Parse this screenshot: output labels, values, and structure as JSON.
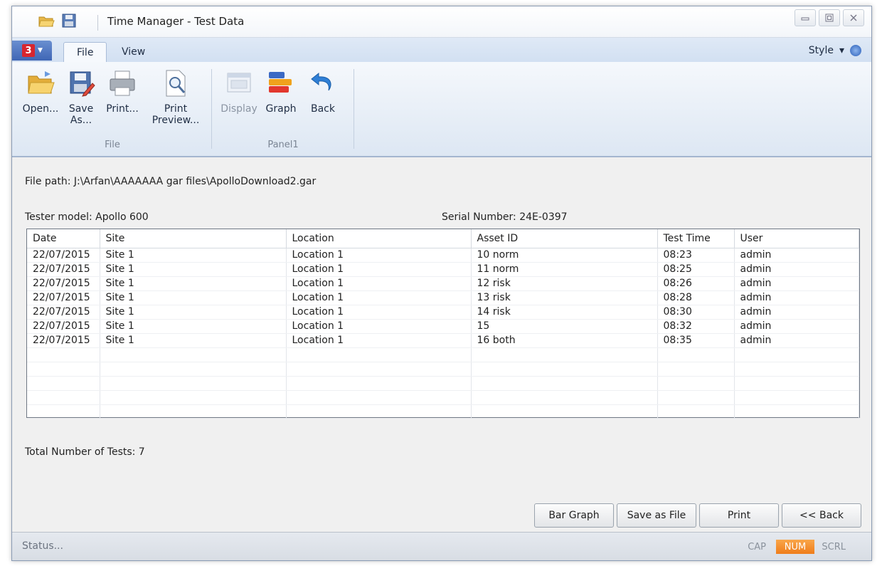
{
  "window": {
    "title": "Time Manager - Test Data"
  },
  "tabs": [
    {
      "label": "File",
      "active": true
    },
    {
      "label": "View",
      "active": false
    }
  ],
  "app_button": {
    "logo_text": "3"
  },
  "style_menu": {
    "label": "Style",
    "arrow": "▾"
  },
  "ribbon": {
    "groups": [
      {
        "label": "File",
        "buttons": [
          {
            "label": "Open...",
            "icon": "folder-open-icon"
          },
          {
            "label": "Save As...",
            "icon": "save-as-icon"
          },
          {
            "label": "Print...",
            "icon": "printer-icon"
          },
          {
            "label": "Print Preview...",
            "icon": "print-preview-icon"
          }
        ]
      },
      {
        "label": "Panel1",
        "buttons": [
          {
            "label": "Display",
            "icon": "display-icon",
            "disabled": true
          },
          {
            "label": "Graph",
            "icon": "graph-icon"
          },
          {
            "label": "Back",
            "icon": "back-arrow-icon"
          }
        ]
      }
    ]
  },
  "info": {
    "file_path": "File path: J:\\Arfan\\AAAAAAA gar files\\ApolloDownload2.gar",
    "tester_model": "Tester model: Apollo 600",
    "serial_number": "Serial Number: 24E-0397",
    "total_tests": "Total Number of Tests: 7"
  },
  "table": {
    "columns": [
      "Date",
      "Site",
      "Location",
      "Asset ID",
      "Test Time",
      "User"
    ],
    "rows": [
      [
        "22/07/2015",
        "Site 1",
        "Location 1",
        "10 norm",
        "08:23",
        "admin"
      ],
      [
        "22/07/2015",
        "Site 1",
        "Location 1",
        "11 norm",
        "08:25",
        "admin"
      ],
      [
        "22/07/2015",
        "Site 1",
        "Location 1",
        "12 risk",
        "08:26",
        "admin"
      ],
      [
        "22/07/2015",
        "Site 1",
        "Location 1",
        "13 risk",
        "08:28",
        "admin"
      ],
      [
        "22/07/2015",
        "Site 1",
        "Location 1",
        "14 risk",
        "08:30",
        "admin"
      ],
      [
        "22/07/2015",
        "Site 1",
        "Location 1",
        "15",
        "08:32",
        "admin"
      ],
      [
        "22/07/2015",
        "Site 1",
        "Location 1",
        "16 both",
        "08:35",
        "admin"
      ]
    ],
    "empty_rows": 5
  },
  "buttons": {
    "bar_graph": "Bar Graph",
    "save_as_file": "Save as File",
    "print": "Print",
    "back": "<< Back"
  },
  "status": {
    "text": "Status...",
    "cap": "CAP",
    "num": "NUM",
    "scrl": "SCRL",
    "num_active": true
  },
  "colors": {
    "num_indicator": "#ef7d1a",
    "logo": "#d7262f",
    "app_button": "#3f66b5"
  }
}
